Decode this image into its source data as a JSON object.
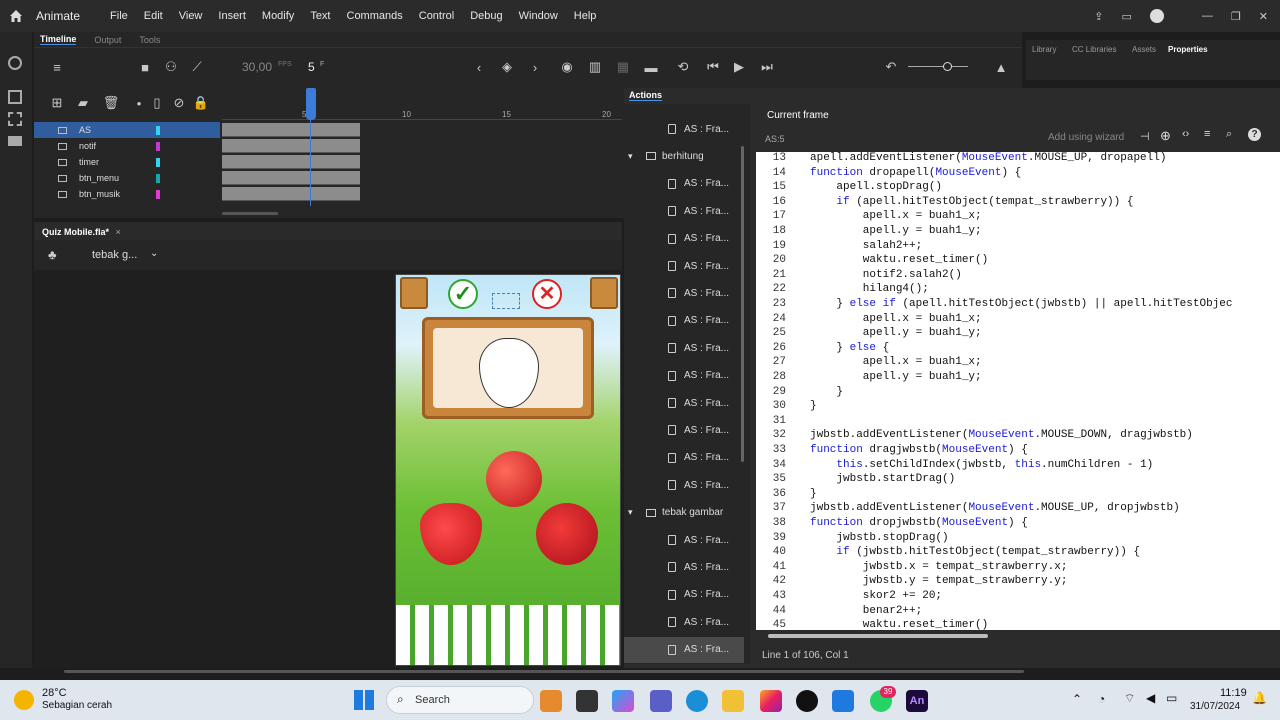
{
  "menubar": {
    "app_name": "Animate",
    "menus": [
      "File",
      "Edit",
      "View",
      "Insert",
      "Modify",
      "Text",
      "Commands",
      "Control",
      "Debug",
      "Window",
      "Help"
    ]
  },
  "timeline": {
    "tabs": [
      "Timeline",
      "Output",
      "Tools"
    ],
    "fps": "30,00",
    "fps_unit": "FPS",
    "frame": "5",
    "frame_unit": "F",
    "ruler": [
      "5",
      "10",
      "15",
      "20"
    ],
    "layers": [
      {
        "name": "AS",
        "color": "#35d3f0"
      },
      {
        "name": "notif",
        "color": "#c03ad6"
      },
      {
        "name": "timer",
        "color": "#35d3f0"
      },
      {
        "name": "btn_menu",
        "color": "#16a8a8"
      },
      {
        "name": "btn_musik",
        "color": "#e23ad6"
      }
    ]
  },
  "right_tabs": [
    "Library",
    "CC Libraries",
    "Assets",
    "Properties"
  ],
  "stage": {
    "doc_tab": "Quiz Mobile.fla*",
    "scene_name": "tebak g..."
  },
  "actions": {
    "title": "Actions",
    "current_frame_label": "Current frame",
    "frame_id": "AS:5",
    "wizard_label": "Add using wizard",
    "status": "Line 1 of 106, Col 1"
  },
  "tree": [
    {
      "type": "item",
      "label": "AS : Fra..."
    },
    {
      "type": "scene",
      "label": "berhitung"
    },
    {
      "type": "item",
      "label": "AS : Fra..."
    },
    {
      "type": "item",
      "label": "AS : Fra..."
    },
    {
      "type": "item",
      "label": "AS : Fra..."
    },
    {
      "type": "item",
      "label": "AS : Fra..."
    },
    {
      "type": "item",
      "label": "AS : Fra..."
    },
    {
      "type": "item",
      "label": "AS : Fra..."
    },
    {
      "type": "item",
      "label": "AS : Fra..."
    },
    {
      "type": "item",
      "label": "AS : Fra..."
    },
    {
      "type": "item",
      "label": "AS : Fra..."
    },
    {
      "type": "item",
      "label": "AS : Fra..."
    },
    {
      "type": "item",
      "label": "AS : Fra..."
    },
    {
      "type": "item",
      "label": "AS : Fra..."
    },
    {
      "type": "scene",
      "label": "tebak gambar"
    },
    {
      "type": "item",
      "label": "AS : Fra..."
    },
    {
      "type": "item",
      "label": "AS : Fra..."
    },
    {
      "type": "item",
      "label": "AS : Fra..."
    },
    {
      "type": "item",
      "label": "AS : Fra..."
    },
    {
      "type": "item",
      "label": "AS : Fra..."
    }
  ],
  "code": [
    {
      "n": "13",
      "t": "apell.addEventListener(MouseEvent.MOUSE_UP, dropapell)"
    },
    {
      "n": "14",
      "t": "function dropapell(MouseEvent) {"
    },
    {
      "n": "15",
      "t": "    apell.stopDrag()"
    },
    {
      "n": "16",
      "t": "    if (apell.hitTestObject(tempat_strawberry)) {"
    },
    {
      "n": "17",
      "t": "        apell.x = buah1_x;"
    },
    {
      "n": "18",
      "t": "        apell.y = buah1_y;"
    },
    {
      "n": "19",
      "t": "        salah2++;"
    },
    {
      "n": "20",
      "t": "        waktu.reset_timer()"
    },
    {
      "n": "21",
      "t": "        notif2.salah2()"
    },
    {
      "n": "22",
      "t": "        hilang4();"
    },
    {
      "n": "23",
      "t": "    } else if (apell.hitTestObject(jwbstb) || apell.hitTestObjec"
    },
    {
      "n": "24",
      "t": "        apell.x = buah1_x;"
    },
    {
      "n": "25",
      "t": "        apell.y = buah1_y;"
    },
    {
      "n": "26",
      "t": "    } else {"
    },
    {
      "n": "27",
      "t": "        apell.x = buah1_x;"
    },
    {
      "n": "28",
      "t": "        apell.y = buah1_y;"
    },
    {
      "n": "29",
      "t": "    }"
    },
    {
      "n": "30",
      "t": "}"
    },
    {
      "n": "31",
      "t": ""
    },
    {
      "n": "32",
      "t": "jwbstb.addEventListener(MouseEvent.MOUSE_DOWN, dragjwbstb)"
    },
    {
      "n": "33",
      "t": "function dragjwbstb(MouseEvent) {"
    },
    {
      "n": "34",
      "t": "    this.setChildIndex(jwbstb, this.numChildren - 1)"
    },
    {
      "n": "35",
      "t": "    jwbstb.startDrag()"
    },
    {
      "n": "36",
      "t": "}"
    },
    {
      "n": "37",
      "t": "jwbstb.addEventListener(MouseEvent.MOUSE_UP, dropjwbstb)"
    },
    {
      "n": "38",
      "t": "function dropjwbstb(MouseEvent) {"
    },
    {
      "n": "39",
      "t": "    jwbstb.stopDrag()"
    },
    {
      "n": "40",
      "t": "    if (jwbstb.hitTestObject(tempat_strawberry)) {"
    },
    {
      "n": "41",
      "t": "        jwbstb.x = tempat_strawberry.x;"
    },
    {
      "n": "42",
      "t": "        jwbstb.y = tempat_strawberry.y;"
    },
    {
      "n": "43",
      "t": "        skor2 += 20;"
    },
    {
      "n": "44",
      "t": "        benar2++;"
    },
    {
      "n": "45",
      "t": "        waktu.reset_timer()"
    }
  ],
  "taskbar": {
    "temp": "28°C",
    "weather": "Sebagian cerah",
    "search": "Search",
    "whatsapp_badge": "39",
    "time": "11:19",
    "date": "31/07/2024"
  }
}
